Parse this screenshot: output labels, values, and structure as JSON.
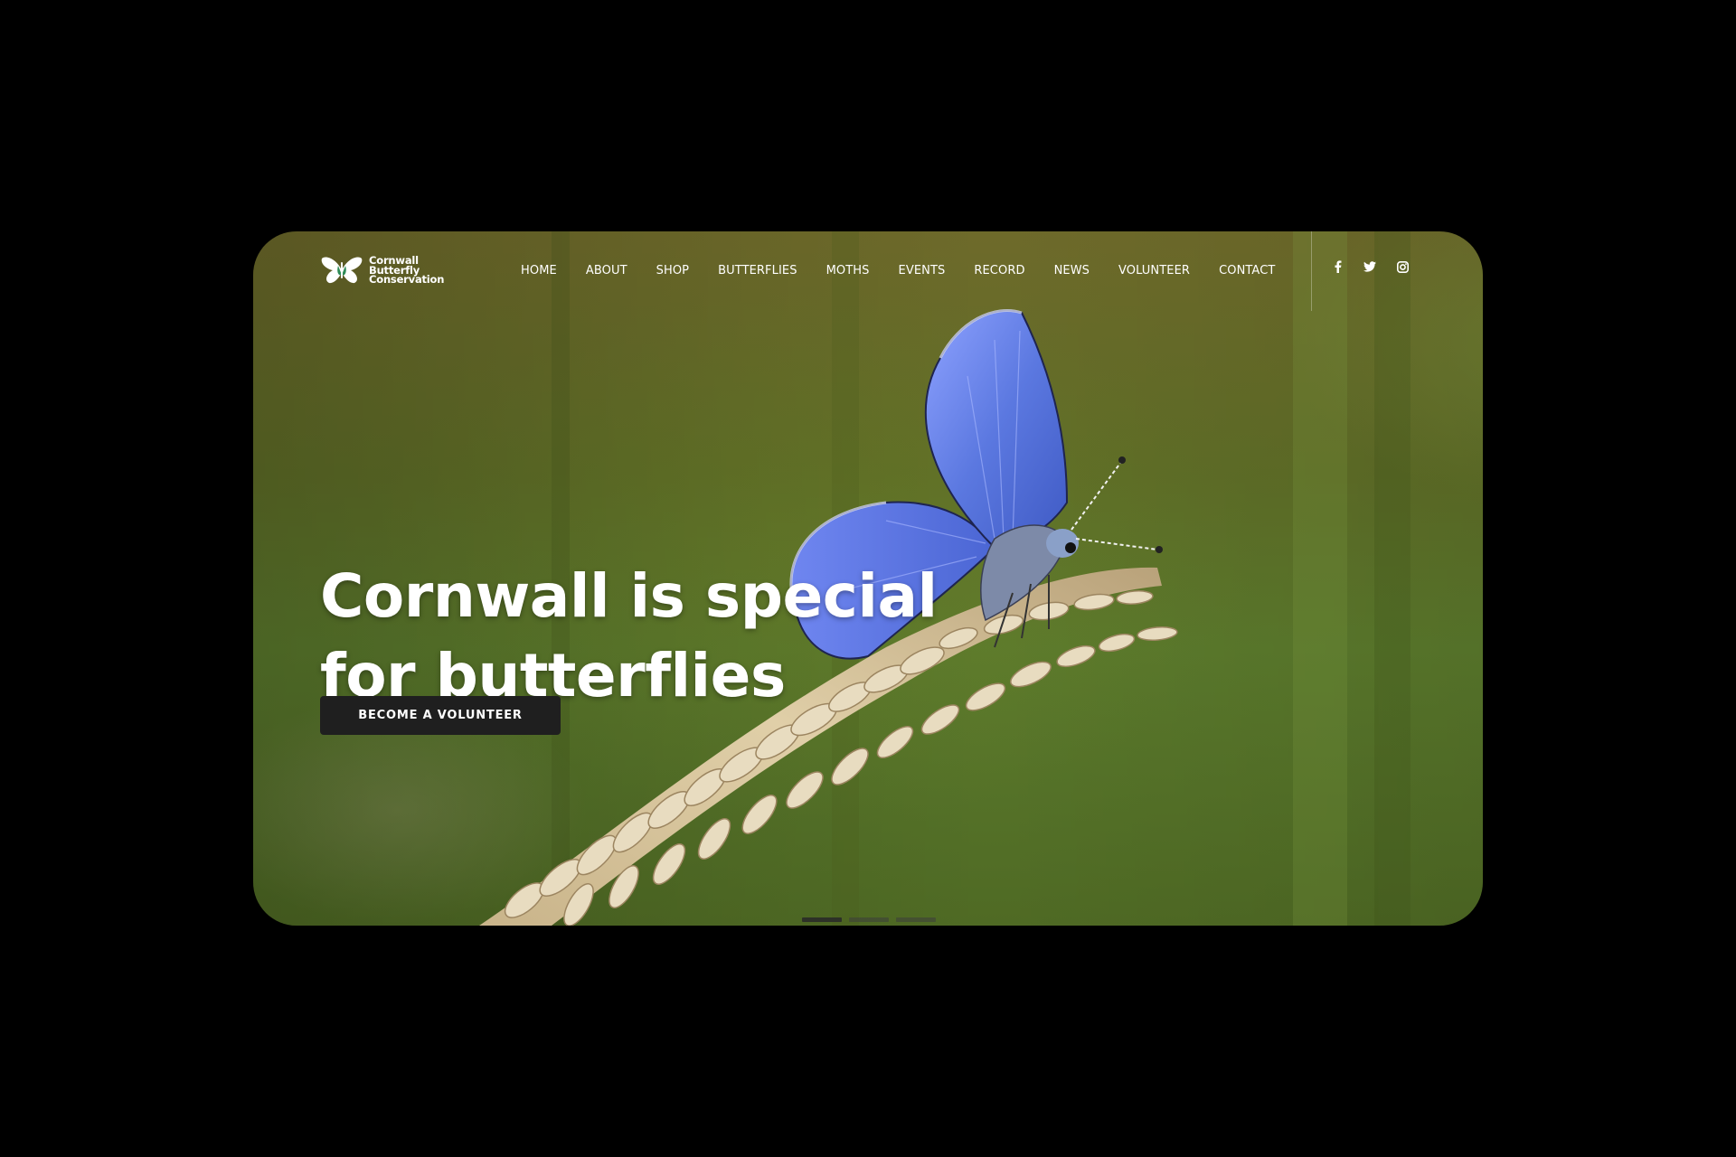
{
  "brand": {
    "name_lines": [
      "Cornwall",
      "Butterfly",
      "Conservation"
    ],
    "logo_icon": "butterfly-logo-icon"
  },
  "nav": {
    "items": [
      "HOME",
      "ABOUT",
      "SHOP",
      "BUTTERFLIES",
      "MOTHS",
      "EVENTS",
      "RECORD",
      "NEWS",
      "VOLUNTEER",
      "CONTACT"
    ]
  },
  "social": {
    "icons": [
      "facebook-icon",
      "twitter-icon",
      "instagram-icon"
    ]
  },
  "hero": {
    "line1": "Cornwall is special",
    "line2": "for butterflies",
    "cta_label": "BECOME A VOLUNTEER"
  },
  "slider": {
    "slide_count": 3,
    "active_index": 0
  },
  "colors": {
    "cta_background": "#1f1f1f",
    "text": "#ffffff",
    "butterfly_blue": "#5b78e0"
  }
}
